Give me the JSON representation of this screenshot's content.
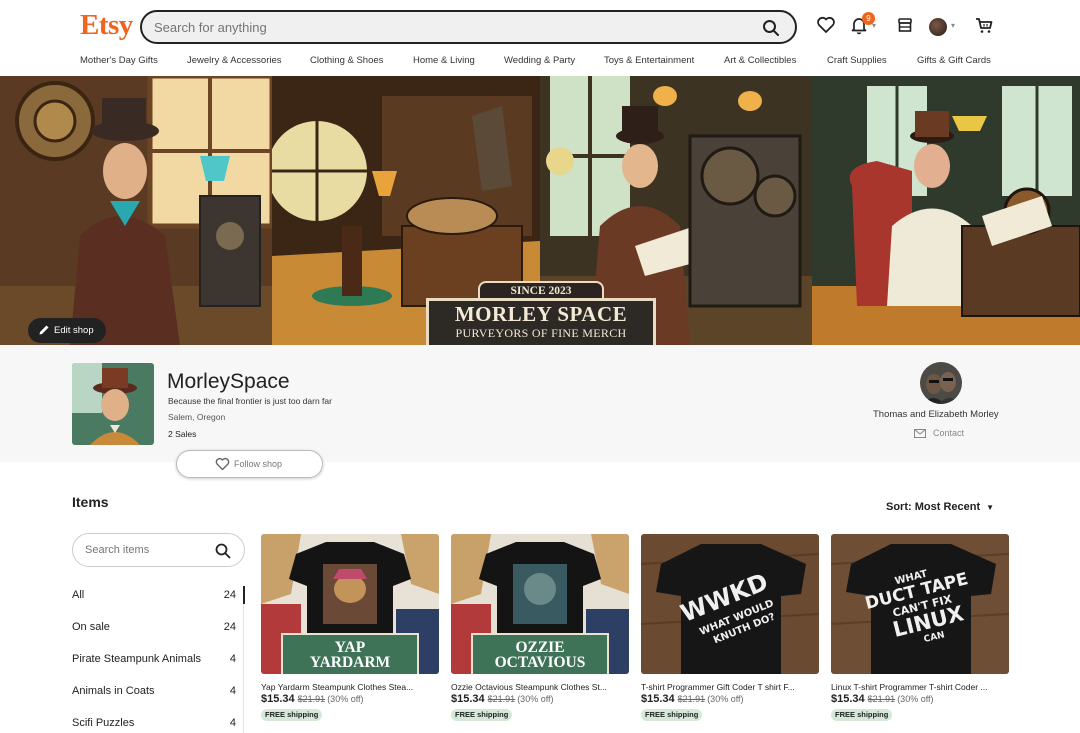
{
  "header": {
    "logo": "Etsy",
    "search_placeholder": "Search for anything",
    "notification_count": "9",
    "icons": [
      "search-icon",
      "heart-icon",
      "bell-icon",
      "shop-icon",
      "avatar",
      "cart-icon"
    ]
  },
  "nav": [
    "Mother's Day Gifts",
    "Jewelry & Accessories",
    "Clothing & Shoes",
    "Home & Living",
    "Wedding & Party",
    "Toys & Entertainment",
    "Art & Collectibles",
    "Craft Supplies",
    "Gifts & Gift Cards"
  ],
  "banner": {
    "edit_label": "Edit shop",
    "sign_top": "SINCE 2023",
    "sign_main": "MORLEY SPACE",
    "sign_sub": "PURVEYORS OF FINE MERCH"
  },
  "shop": {
    "name": "MorleySpace",
    "tagline": "Because the final frontier is just too darn far",
    "location": "Salem, Oregon",
    "sales": "2 Sales",
    "follow_label": "Follow shop",
    "owner_name": "Thomas and Elizabeth Morley",
    "contact_label": "Contact"
  },
  "items": {
    "title": "Items",
    "sort_label": "Sort: Most Recent",
    "search_placeholder": "Search items",
    "categories": [
      {
        "label": "All",
        "count": "24"
      },
      {
        "label": "On sale",
        "count": "24"
      },
      {
        "label": "Pirate Steampunk Animals",
        "count": "4"
      },
      {
        "label": "Animals in Coats",
        "count": "4"
      },
      {
        "label": "Scifi Puzzles",
        "count": "4"
      }
    ],
    "listings": [
      {
        "title": "Yap Yardarm Steampunk Clothes Stea...",
        "price": "$15.34",
        "original": "$21.91",
        "discount": "(30% off)",
        "shipping": "FREE shipping",
        "image_text": [
          "YAP",
          "YARDARM"
        ]
      },
      {
        "title": "Ozzie Octavious Steampunk Clothes St...",
        "price": "$15.34",
        "original": "$21.91",
        "discount": "(30% off)",
        "shipping": "FREE shipping",
        "image_text": [
          "OZZIE",
          "OCTAVIOUS"
        ]
      },
      {
        "title": "T-shirt Programmer Gift Coder T shirt F...",
        "price": "$15.34",
        "original": "$21.91",
        "discount": "(30% off)",
        "shipping": "FREE shipping",
        "image_text": [
          "WWKD",
          "WHAT WOULD",
          "KNUTH DO?"
        ]
      },
      {
        "title": "Linux T-shirt Programmer T-shirt Coder ...",
        "price": "$15.34",
        "original": "$21.91",
        "discount": "(30% off)",
        "shipping": "FREE shipping",
        "image_text": [
          "WHAT",
          "DUCT TAPE",
          "CAN'T FIX",
          "LINUX",
          "CAN"
        ]
      }
    ]
  },
  "colors": {
    "brand": "#f1641e",
    "label_green": "#3e7358",
    "shipping_badge": "#d4e9d7"
  }
}
